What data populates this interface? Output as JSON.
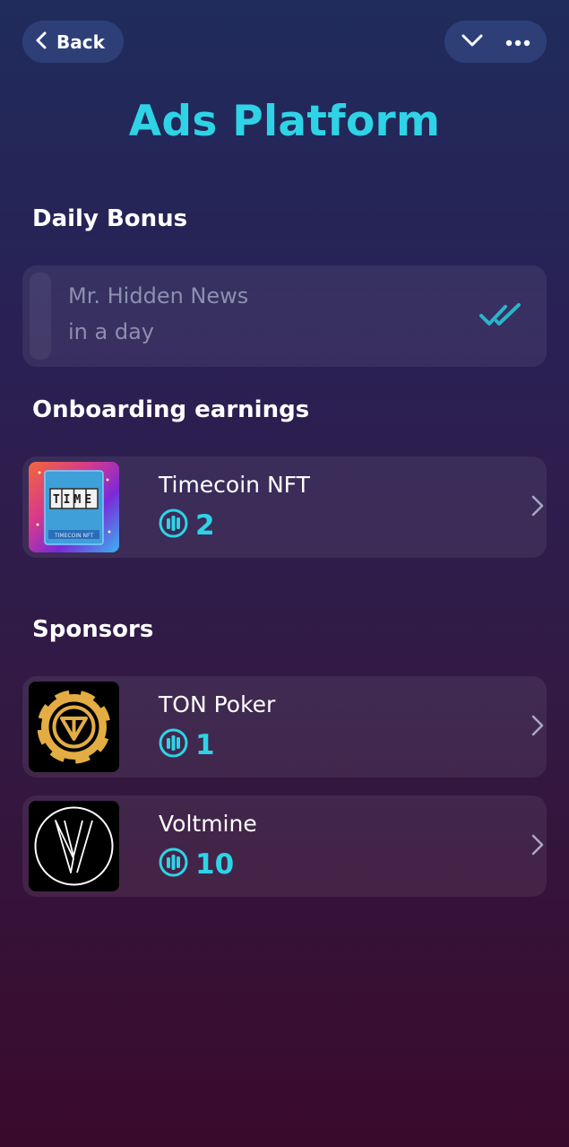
{
  "header": {
    "back_label": "Back",
    "title": "Ads Platform"
  },
  "daily_bonus": {
    "heading": "Daily Bonus",
    "item_name": "Mr. Hidden News",
    "item_status": "in a day"
  },
  "onboarding": {
    "heading": "Onboarding earnings",
    "items": [
      {
        "name": "Timecoin NFT",
        "reward": "2",
        "thumb_text": "TIME",
        "thumb_caption": "TIMECOIN NFT"
      }
    ]
  },
  "sponsors": {
    "heading": "Sponsors",
    "items": [
      {
        "name": "TON Poker",
        "reward": "1"
      },
      {
        "name": "Voltmine",
        "reward": "10"
      }
    ]
  },
  "colors": {
    "accent": "#2ed3e6",
    "card": "#3a2f5c",
    "gold": "#e3ad43"
  }
}
